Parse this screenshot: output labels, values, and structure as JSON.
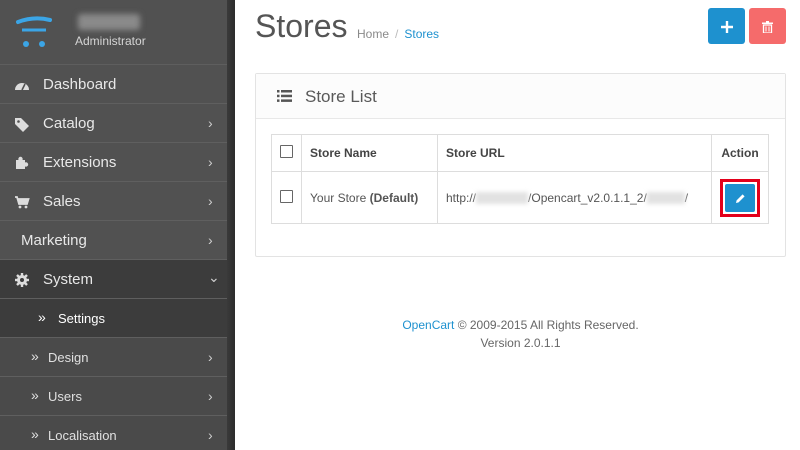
{
  "sidebar": {
    "role": "Administrator",
    "menu": [
      {
        "label": "Dashboard",
        "icon": "dashboard-icon"
      },
      {
        "label": "Catalog",
        "icon": "tags-icon"
      },
      {
        "label": "Extensions",
        "icon": "puzzle-icon"
      },
      {
        "label": "Sales",
        "icon": "shopping-cart-icon"
      },
      {
        "label": "Marketing"
      },
      {
        "label": "System",
        "icon": "gear-icon"
      }
    ],
    "submenu": [
      {
        "label": "Settings"
      },
      {
        "label": "Design"
      },
      {
        "label": "Users"
      },
      {
        "label": "Localisation"
      }
    ]
  },
  "header": {
    "title": "Stores",
    "breadcrumb": [
      "Home",
      "Stores"
    ],
    "add_icon": "plus-icon",
    "delete_icon": "trash-icon"
  },
  "panel": {
    "title": "Store List",
    "columns": {
      "name": "Store Name",
      "url": "Store URL",
      "action": "Action"
    },
    "rows": [
      {
        "name": "Your Store",
        "default_label": "(Default)",
        "url_prefix": "http://",
        "url_middle": "/Opencart_v2.0.1.1_2/",
        "url_suffix": "/"
      }
    ]
  },
  "footer": {
    "link": "OpenCart",
    "copyright": " © 2009-2015 All Rights Reserved.",
    "version": "Version 2.0.1.1"
  },
  "colors": {
    "accent": "#1e91cf",
    "danger": "#f56b6b",
    "sidebar": "#515151"
  }
}
